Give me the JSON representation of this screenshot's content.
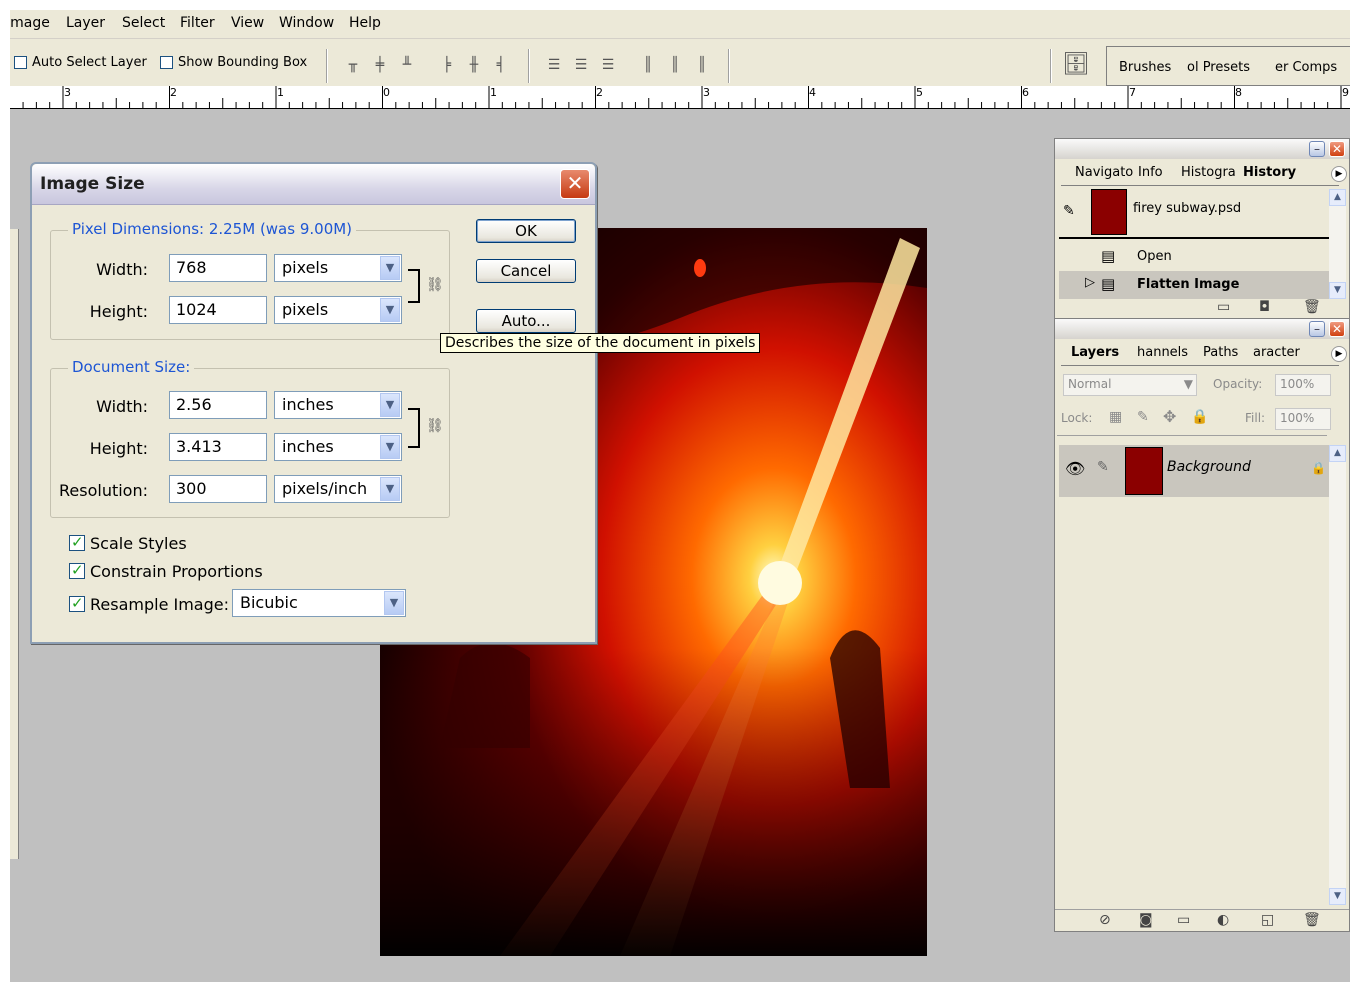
{
  "menu": [
    "Image",
    "Layer",
    "Select",
    "Filter",
    "View",
    "Window",
    "Help"
  ],
  "options": {
    "auto_select": "Auto Select Layer",
    "show_bbox": "Show Bounding Box",
    "auto_select_checked": false,
    "show_bbox_checked": false
  },
  "well_tabs": [
    "Brushes",
    "Tool Presets",
    "Layer Comps"
  ],
  "well_tabs_visible": [
    "Brushes",
    "ol Presets",
    "er Comps"
  ],
  "ruler": [
    "3",
    "2",
    "1",
    "0",
    "1",
    "2",
    "3",
    "4",
    "5",
    "6",
    "7",
    "8",
    "9"
  ],
  "dialog": {
    "title": "Image Size",
    "pixel_dimensions": "Pixel Dimensions:  2.25M (was 9.00M)",
    "pixel": {
      "width_label": "Width:",
      "width_value": "768",
      "width_unit": "pixels",
      "height_label": "Height:",
      "height_value": "1024",
      "height_unit": "pixels"
    },
    "document_size": "Document Size:",
    "doc": {
      "width_label": "Width:",
      "width_value": "2.56",
      "width_unit": "inches",
      "height_label": "Height:",
      "height_value": "3.413",
      "height_unit": "inches",
      "res_label": "Resolution:",
      "res_value": "300",
      "res_unit": "pixels/inch"
    },
    "scale_styles": "Scale Styles",
    "constrain": "Constrain Proportions",
    "resample": "Resample Image:",
    "resample_value": "Bicubic",
    "ok": "OK",
    "cancel": "Cancel",
    "auto": "Auto...",
    "tooltip": "Describes the size of the document in pixels"
  },
  "history_panel": {
    "tabs": [
      "Navigator",
      "Info",
      "Histogram",
      "History"
    ],
    "tabs_visible": [
      "Navigato",
      "Info",
      "Histogra",
      "History"
    ],
    "snapshot": "firey subway.psd",
    "steps": [
      "Open",
      "Flatten Image"
    ]
  },
  "layers_panel": {
    "tabs": [
      "Layers",
      "Channels",
      "Paths",
      "Character"
    ],
    "tabs_visible": [
      "Layers",
      "hannels",
      "Paths",
      "aracter"
    ],
    "blend_mode": "Normal",
    "opacity_label": "Opacity:",
    "opacity_value": "100%",
    "lock_label": "Lock:",
    "fill_label": "Fill:",
    "fill_value": "100%",
    "layer_name": "Background"
  },
  "colors": {
    "dialog_label": "#1d55d4",
    "chrome": "#ece9d8",
    "canvas": "#c0c0c0"
  }
}
